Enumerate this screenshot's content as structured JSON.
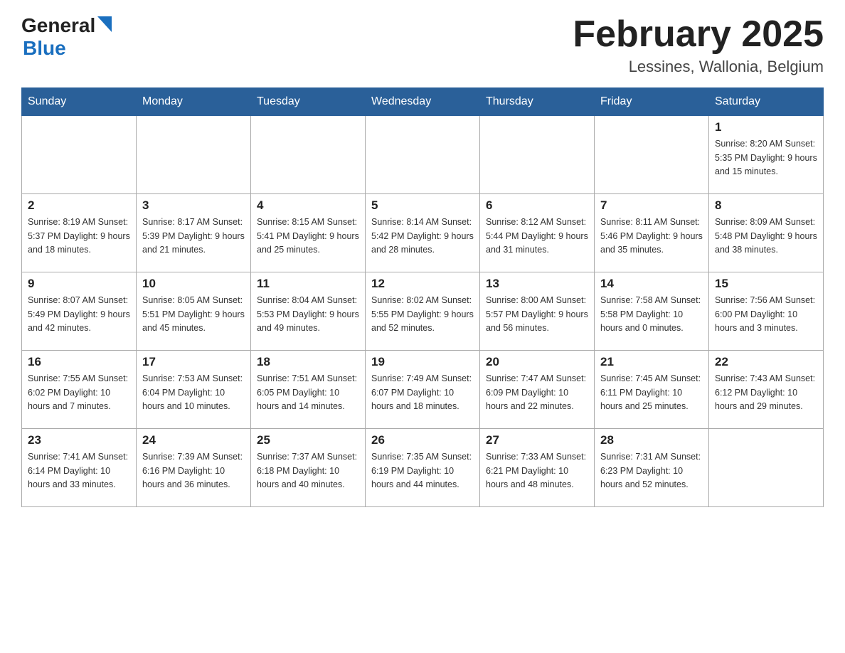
{
  "header": {
    "month_title": "February 2025",
    "location": "Lessines, Wallonia, Belgium",
    "logo_general": "General",
    "logo_blue": "Blue"
  },
  "days_of_week": [
    "Sunday",
    "Monday",
    "Tuesday",
    "Wednesday",
    "Thursday",
    "Friday",
    "Saturday"
  ],
  "weeks": [
    [
      {
        "day": "",
        "info": ""
      },
      {
        "day": "",
        "info": ""
      },
      {
        "day": "",
        "info": ""
      },
      {
        "day": "",
        "info": ""
      },
      {
        "day": "",
        "info": ""
      },
      {
        "day": "",
        "info": ""
      },
      {
        "day": "1",
        "info": "Sunrise: 8:20 AM\nSunset: 5:35 PM\nDaylight: 9 hours\nand 15 minutes."
      }
    ],
    [
      {
        "day": "2",
        "info": "Sunrise: 8:19 AM\nSunset: 5:37 PM\nDaylight: 9 hours\nand 18 minutes."
      },
      {
        "day": "3",
        "info": "Sunrise: 8:17 AM\nSunset: 5:39 PM\nDaylight: 9 hours\nand 21 minutes."
      },
      {
        "day": "4",
        "info": "Sunrise: 8:15 AM\nSunset: 5:41 PM\nDaylight: 9 hours\nand 25 minutes."
      },
      {
        "day": "5",
        "info": "Sunrise: 8:14 AM\nSunset: 5:42 PM\nDaylight: 9 hours\nand 28 minutes."
      },
      {
        "day": "6",
        "info": "Sunrise: 8:12 AM\nSunset: 5:44 PM\nDaylight: 9 hours\nand 31 minutes."
      },
      {
        "day": "7",
        "info": "Sunrise: 8:11 AM\nSunset: 5:46 PM\nDaylight: 9 hours\nand 35 minutes."
      },
      {
        "day": "8",
        "info": "Sunrise: 8:09 AM\nSunset: 5:48 PM\nDaylight: 9 hours\nand 38 minutes."
      }
    ],
    [
      {
        "day": "9",
        "info": "Sunrise: 8:07 AM\nSunset: 5:49 PM\nDaylight: 9 hours\nand 42 minutes."
      },
      {
        "day": "10",
        "info": "Sunrise: 8:05 AM\nSunset: 5:51 PM\nDaylight: 9 hours\nand 45 minutes."
      },
      {
        "day": "11",
        "info": "Sunrise: 8:04 AM\nSunset: 5:53 PM\nDaylight: 9 hours\nand 49 minutes."
      },
      {
        "day": "12",
        "info": "Sunrise: 8:02 AM\nSunset: 5:55 PM\nDaylight: 9 hours\nand 52 minutes."
      },
      {
        "day": "13",
        "info": "Sunrise: 8:00 AM\nSunset: 5:57 PM\nDaylight: 9 hours\nand 56 minutes."
      },
      {
        "day": "14",
        "info": "Sunrise: 7:58 AM\nSunset: 5:58 PM\nDaylight: 10 hours\nand 0 minutes."
      },
      {
        "day": "15",
        "info": "Sunrise: 7:56 AM\nSunset: 6:00 PM\nDaylight: 10 hours\nand 3 minutes."
      }
    ],
    [
      {
        "day": "16",
        "info": "Sunrise: 7:55 AM\nSunset: 6:02 PM\nDaylight: 10 hours\nand 7 minutes."
      },
      {
        "day": "17",
        "info": "Sunrise: 7:53 AM\nSunset: 6:04 PM\nDaylight: 10 hours\nand 10 minutes."
      },
      {
        "day": "18",
        "info": "Sunrise: 7:51 AM\nSunset: 6:05 PM\nDaylight: 10 hours\nand 14 minutes."
      },
      {
        "day": "19",
        "info": "Sunrise: 7:49 AM\nSunset: 6:07 PM\nDaylight: 10 hours\nand 18 minutes."
      },
      {
        "day": "20",
        "info": "Sunrise: 7:47 AM\nSunset: 6:09 PM\nDaylight: 10 hours\nand 22 minutes."
      },
      {
        "day": "21",
        "info": "Sunrise: 7:45 AM\nSunset: 6:11 PM\nDaylight: 10 hours\nand 25 minutes."
      },
      {
        "day": "22",
        "info": "Sunrise: 7:43 AM\nSunset: 6:12 PM\nDaylight: 10 hours\nand 29 minutes."
      }
    ],
    [
      {
        "day": "23",
        "info": "Sunrise: 7:41 AM\nSunset: 6:14 PM\nDaylight: 10 hours\nand 33 minutes."
      },
      {
        "day": "24",
        "info": "Sunrise: 7:39 AM\nSunset: 6:16 PM\nDaylight: 10 hours\nand 36 minutes."
      },
      {
        "day": "25",
        "info": "Sunrise: 7:37 AM\nSunset: 6:18 PM\nDaylight: 10 hours\nand 40 minutes."
      },
      {
        "day": "26",
        "info": "Sunrise: 7:35 AM\nSunset: 6:19 PM\nDaylight: 10 hours\nand 44 minutes."
      },
      {
        "day": "27",
        "info": "Sunrise: 7:33 AM\nSunset: 6:21 PM\nDaylight: 10 hours\nand 48 minutes."
      },
      {
        "day": "28",
        "info": "Sunrise: 7:31 AM\nSunset: 6:23 PM\nDaylight: 10 hours\nand 52 minutes."
      },
      {
        "day": "",
        "info": ""
      }
    ]
  ]
}
